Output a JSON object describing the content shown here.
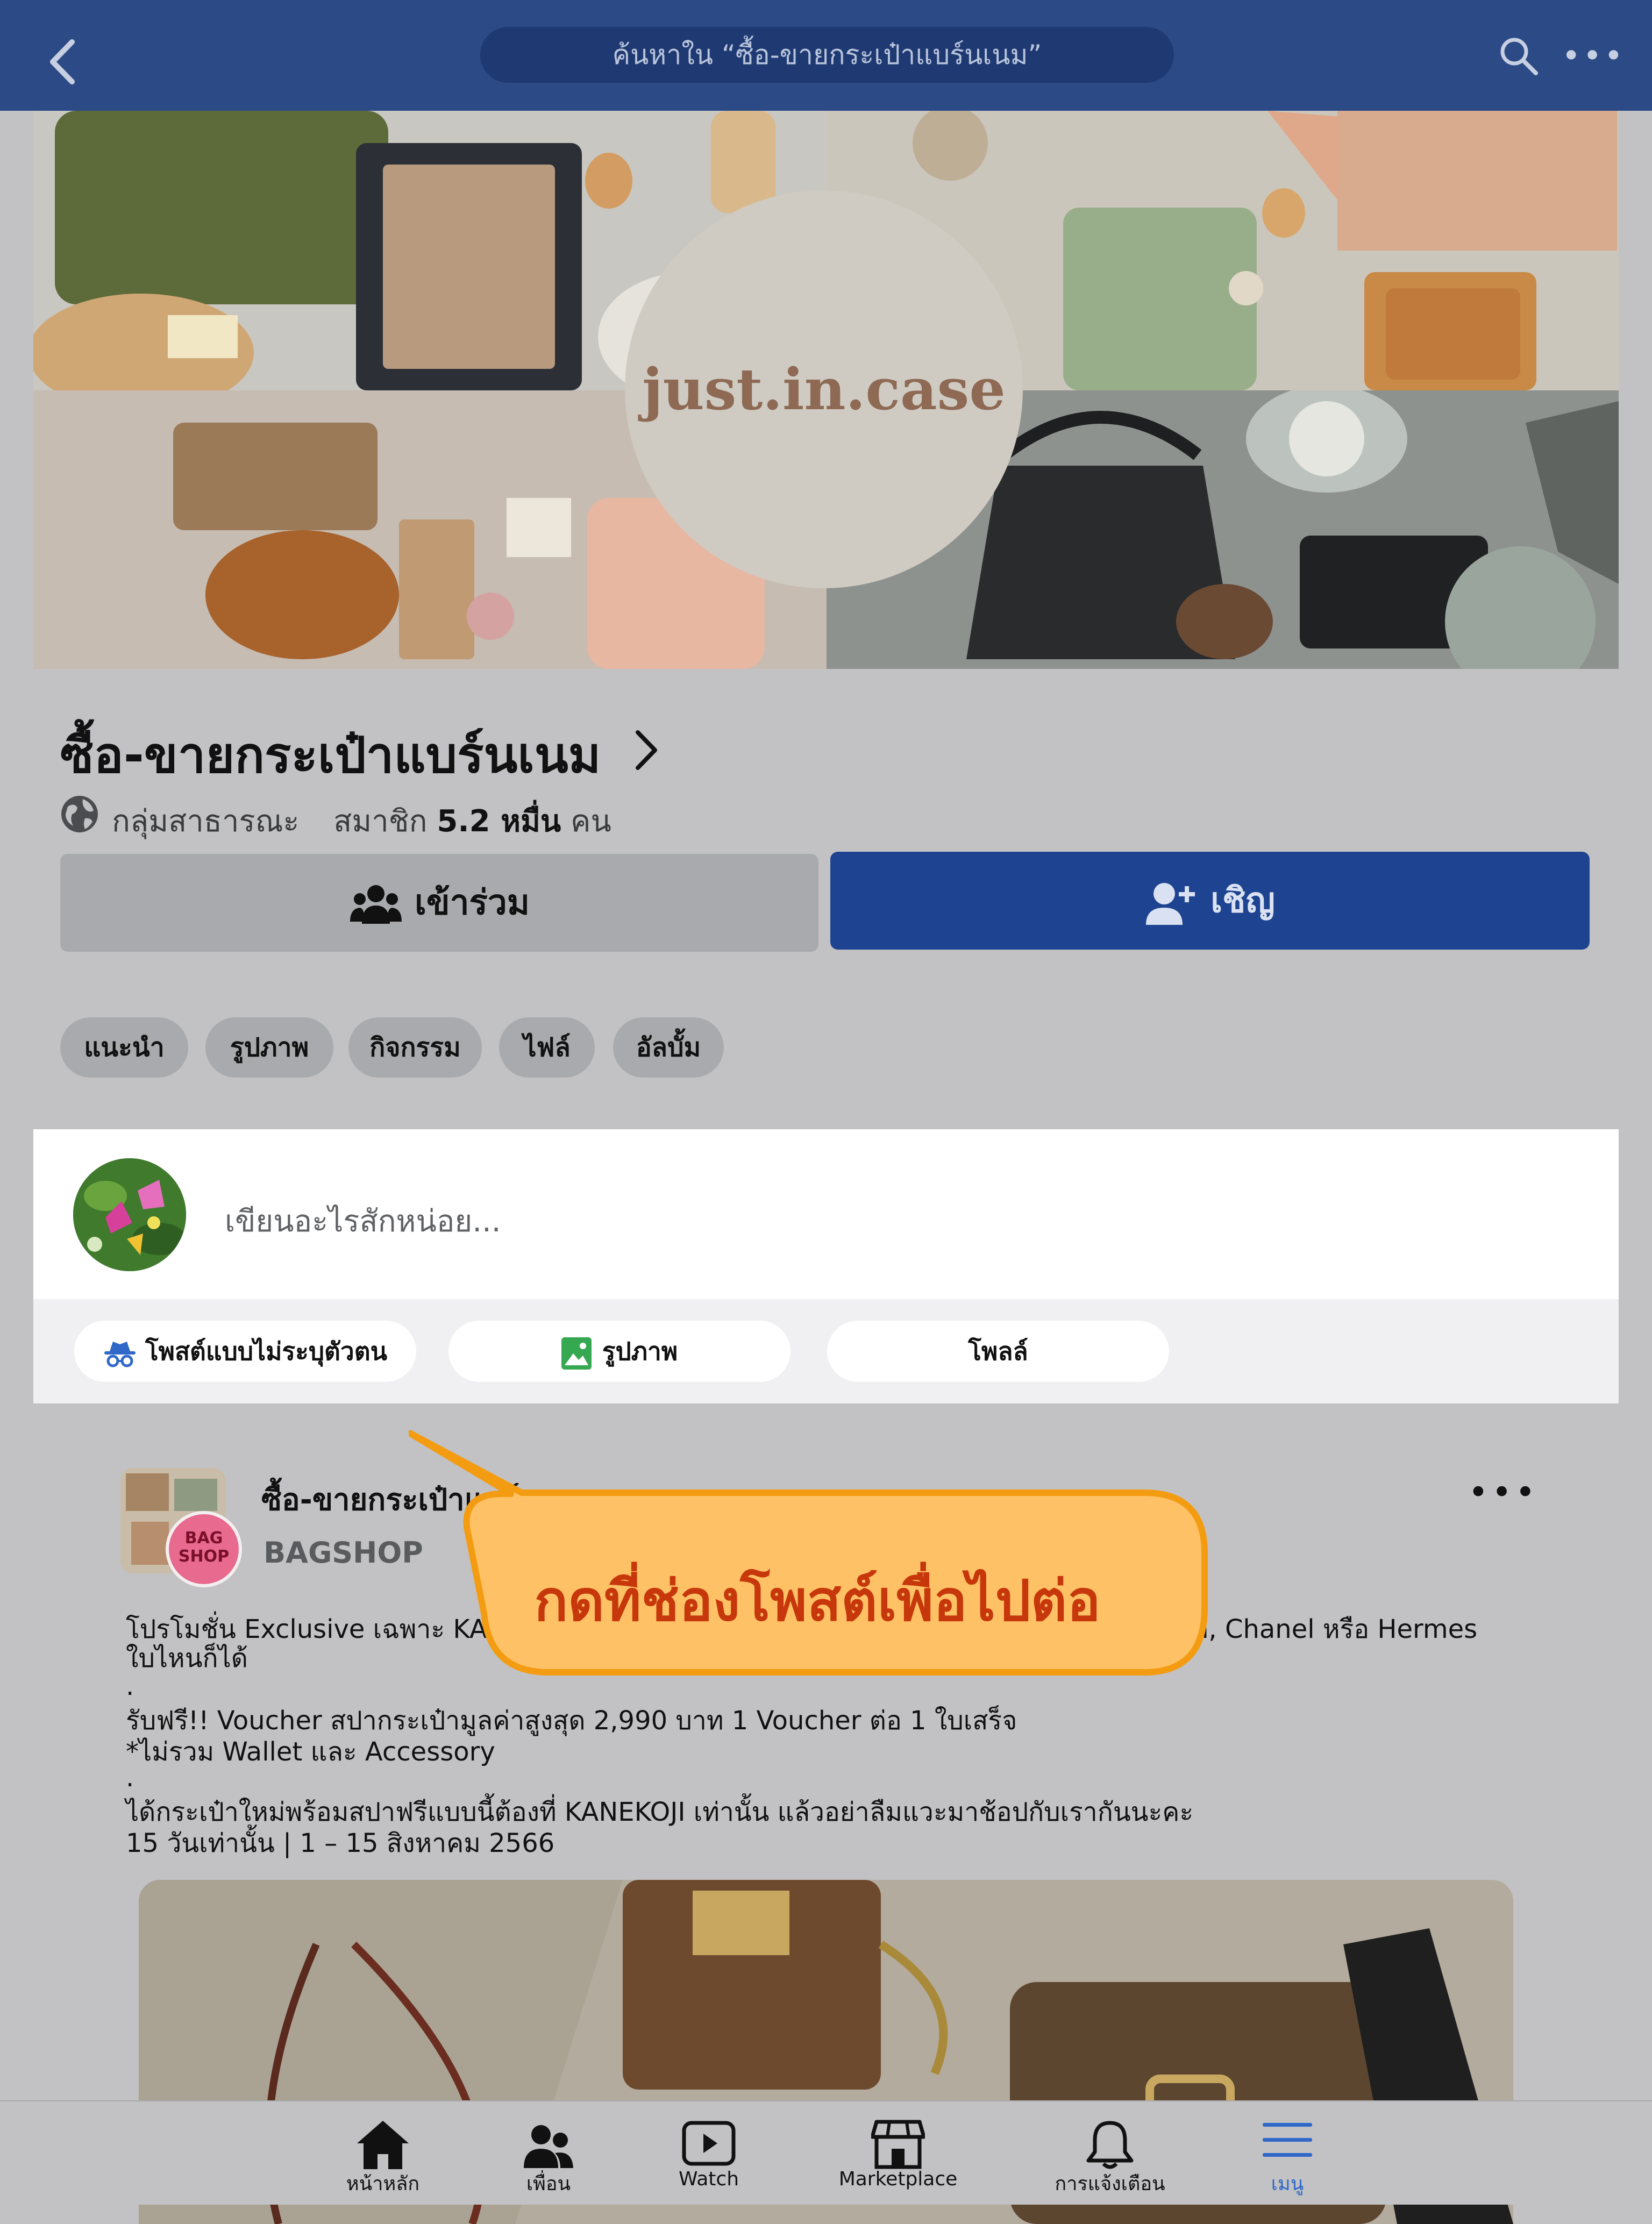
{
  "topbar": {
    "search_text": "ค้นหาใน “ซื้อ-ขายกระเป๋าแบร์นเนม”",
    "more": "•••"
  },
  "cover": {
    "logo_text": "just.in.case"
  },
  "group": {
    "title": "ซื้อ-ขายกระเป๋าแบร์นเนม",
    "privacy": "กลุ่มสาธารณะ",
    "members_label": "สมาชิก",
    "members_count": "5.2 หมื่น",
    "members_unit": "คน",
    "join_label": "เข้าร่วม",
    "invite_label": "เชิญ"
  },
  "tabs": [
    "แนะนำ",
    "รูปภาพ",
    "กิจกรรม",
    "ไฟล์",
    "อัลบั้ม"
  ],
  "composer": {
    "placeholder": "เขียนอะไรสักหน่อย...",
    "chips": [
      "โพสต์แบบไม่ระบุตัวตน",
      "รูปภาพ",
      "โพลล์"
    ]
  },
  "post": {
    "author": "ซื้อ-ขายกระเป๋าแบร์นเนม",
    "subtitle": "BAGSHOP",
    "badge_line1": "BAG",
    "badge_line2": "SHOP",
    "more": "•••",
    "lines": [
      "โปรโมชั่น Exclusive เฉพาะ KANEKOJI ส่งสปากระเป๋าแบรนด์เนมได้ ไม่ว่าจะเป็น Louis Vuitton, Chanel หรือ Hermes",
      "ใบไหนก็ได้",
      ".",
      "รับฟรี!! Voucher สปากระเป๋ามูลค่าสูงสุด 2,990 บาท 1 Voucher ต่อ 1 ใบเสร็จ",
      "*ไม่รวม Wallet และ Accessory",
      ".",
      "ได้กระเป๋าใหม่พร้อมสปาฟรีแบบนี้ต้องที่ KANEKOJI เท่านั้น แล้วอย่าลืมแวะมาช้อปกับเรากันนะคะ",
      "15 วันเท่านั้น | 1 – 15 สิงหาคม 2566"
    ]
  },
  "callout": {
    "text": "กดที่ช่องโพสต์เพื่อไปต่อ"
  },
  "bottom_nav": [
    {
      "label": "หน้าหลัก",
      "icon": "home-icon"
    },
    {
      "label": "เพื่อน",
      "icon": "friends-icon"
    },
    {
      "label": "Watch",
      "icon": "watch-icon"
    },
    {
      "label": "Marketplace",
      "icon": "marketplace-icon"
    },
    {
      "label": "การแจ้งเตือน",
      "icon": "bell-icon"
    },
    {
      "label": "เมนู",
      "icon": "menu-icon"
    }
  ],
  "colors": {
    "topbar": "#2c4a85",
    "invite": "#1e4390",
    "callout_fill": "#ffc165",
    "callout_border": "#f39c12",
    "callout_text": "#c7370c",
    "menu_active": "#2f68c9"
  }
}
